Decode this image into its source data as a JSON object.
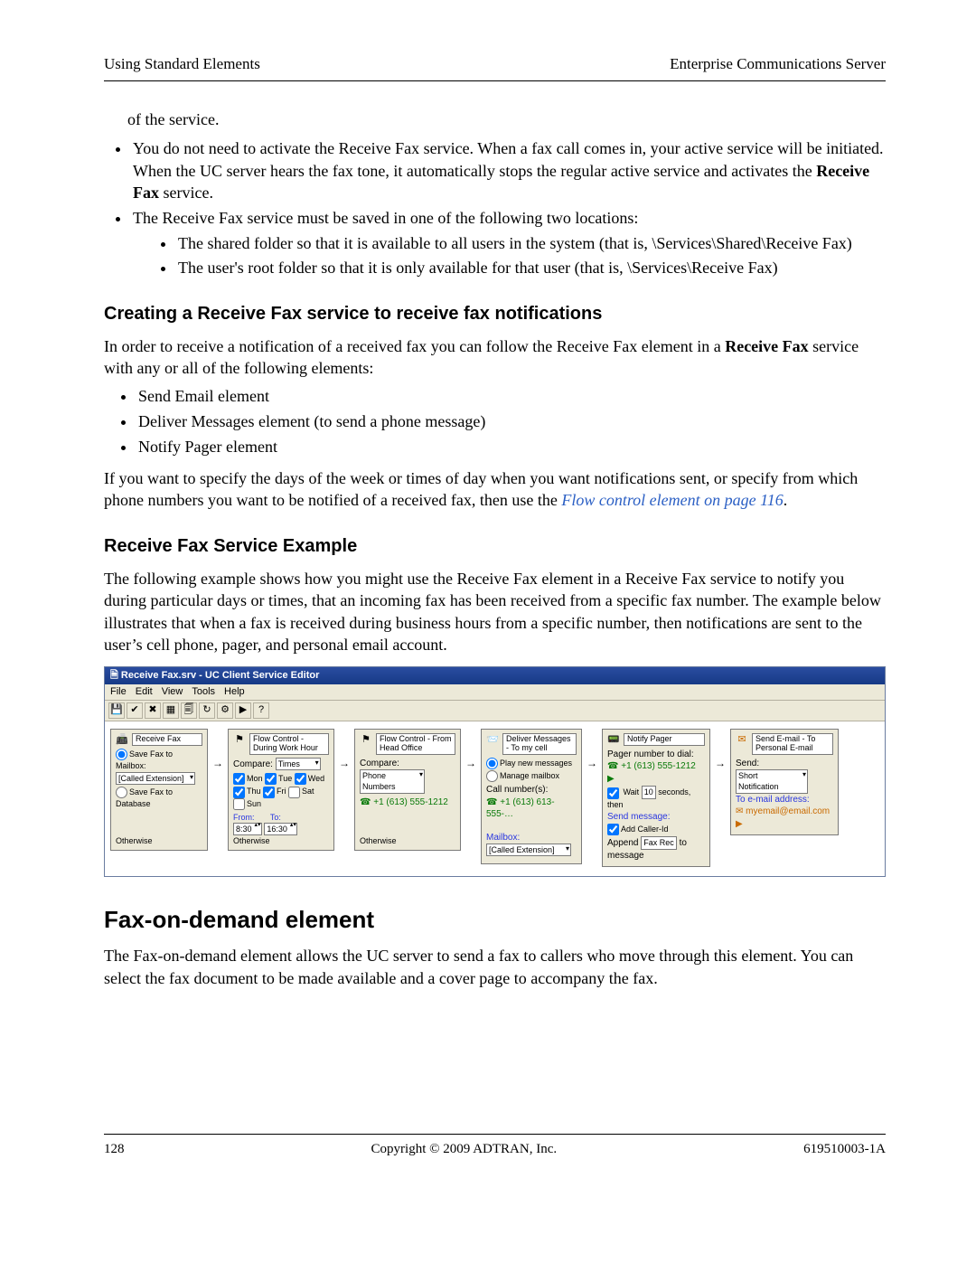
{
  "header": {
    "left": "Using Standard Elements",
    "right": "Enterprise Communications Server"
  },
  "intro_tail": "of the service.",
  "bullets_top": [
    {
      "pre": "You do not need to activate the Receive Fax service. When a fax call comes in, your active service will be initiated. When the UC server hears the fax tone, it automatically stops the regular active service and activates the ",
      "bold": "Receive Fax",
      "post": " service."
    }
  ],
  "bullet_loc_lead": "The Receive Fax service must be saved in one of the following two locations:",
  "sub_bullets": [
    "The shared folder so that it is available to all users in the system (that is, \\Services\\Shared\\Receive Fax)",
    "The user's root folder so that it is only available for that user (that is, \\Services\\Receive Fax)"
  ],
  "h_create": "Creating a Receive Fax service to receive fax notifications",
  "p_create": {
    "pre": "In order to receive a notification of a received fax you can follow the Receive Fax element in a ",
    "bold": "Receive Fax",
    "post": " service with any or all of the following elements:"
  },
  "elements": [
    "Send Email element",
    "Deliver Messages element (to send a phone message)",
    "Notify Pager element"
  ],
  "p_flow": {
    "pre": "If you want to specify the days of the week or times of day when you want notifications sent, or specify from which phone numbers you want to be notified of a received fax, then use the ",
    "link": "Flow control element on page 116",
    "post": "."
  },
  "h_example": "Receive Fax Service Example",
  "p_example": "The following example shows how you might use the Receive Fax element in a Receive Fax service to notify you during particular days or times, that an incoming fax has been received from a specific fax number. The example below illustrates that when a fax is received during business hours from a specific number, then notifications are sent to the user’s cell phone, pager, and personal email account.",
  "figure": {
    "title": "Receive Fax.srv - UC Client Service Editor",
    "menus": [
      "File",
      "Edit",
      "View",
      "Tools",
      "Help"
    ],
    "toolbar": [
      "💾",
      "✔",
      "✖",
      "▦",
      "🗐",
      "↻",
      "⚙",
      "▶",
      "?"
    ],
    "b1": {
      "title": "Receive Fax",
      "r1_label": "Save Fax to Mailbox:",
      "r1_value": "[Called Extension]",
      "r2_label": "Save Fax to Database",
      "else": "Otherwise"
    },
    "b2": {
      "title": "Flow Control - During Work Hour",
      "compare_label": "Compare:",
      "compare_value": "Times",
      "days": [
        "Mon",
        "Tue",
        "Wed",
        "Thu",
        "Fri",
        "Sat",
        "Sun"
      ],
      "from_label": "From:",
      "to_label": "To:",
      "from": "8:30",
      "to": "16:30",
      "else": "Otherwise"
    },
    "b3": {
      "title": "Flow Control - From Head Office",
      "compare_label": "Compare:",
      "compare_value": "Phone Numbers",
      "phone": "+1 (613) 555-1212",
      "else": "Otherwise"
    },
    "b4": {
      "title": "Deliver Messages - To my cell",
      "opt1": "Play new messages",
      "opt2": "Manage mailbox",
      "callnum_label": "Call number(s):",
      "phone": "+1 (613) 613-555-…",
      "mailbox_label": "Mailbox:",
      "mailbox_value": "[Called Extension]"
    },
    "b5": {
      "title": "Notify Pager",
      "pager_label": "Pager number to dial:",
      "pager_value": "+1 (613) 555-1212",
      "wait_pre": "Wait",
      "wait_secs": "10",
      "wait_post": "seconds, then",
      "send_label": "Send message:",
      "add_caller": "Add Caller-Id",
      "append_label": "Append",
      "append_value": "Fax Rec",
      "append_post": "to message"
    },
    "b6": {
      "title": "Send E-mail - To Personal E-mail",
      "send_label": "Send:",
      "send_value": "Short Notification",
      "addr_label": "To e-mail address:",
      "addr_value": "myemail@email.com"
    }
  },
  "h_fod": "Fax-on-demand element",
  "p_fod": "The Fax-on-demand element allows the UC server to send a fax to callers who move through this element. You can select the fax document to be made available and a cover page to accompany the fax.",
  "footer": {
    "page": "128",
    "mid": "Copyright © 2009 ADTRAN, Inc.",
    "right": "619510003-1A"
  }
}
